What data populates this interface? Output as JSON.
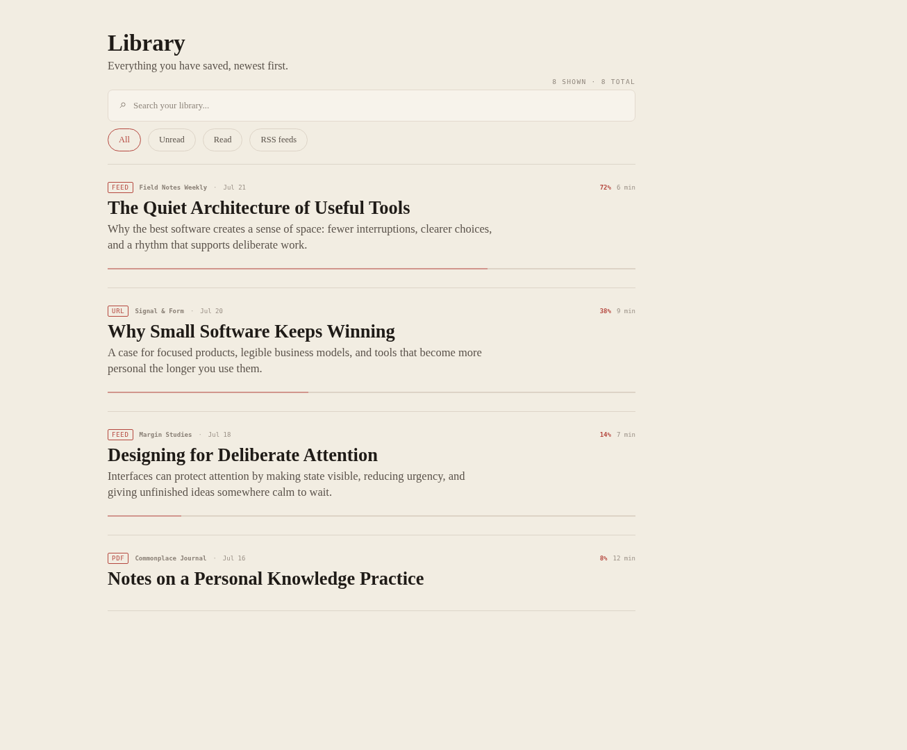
{
  "page": {
    "title": "Library",
    "subtitle": "Everything you have saved, newest first.",
    "count": "8 SHOWN · 8 TOTAL"
  },
  "search": {
    "placeholder": "Search your library..."
  },
  "filters": [
    {
      "label": "All",
      "selected": true
    },
    {
      "label": "Unread",
      "selected": false
    },
    {
      "label": "Read",
      "selected": false
    },
    {
      "label": "RSS feeds",
      "selected": false
    }
  ],
  "items": [
    {
      "type": "FEED",
      "source": "Field Notes Weekly",
      "separator": "·",
      "date": "Jul 21",
      "percent": "72%",
      "duration": "6 min",
      "title": "The Quiet Architecture of Useful Tools",
      "summary": "Why the best software creates a sense of space: fewer interruptions, clearer choices, and a rhythm that supports deliberate work.",
      "level": 0.72
    },
    {
      "type": "URL",
      "source": "Signal & Form",
      "separator": "·",
      "date": "Jul 20",
      "percent": "38%",
      "duration": "9 min",
      "title": "Why Small Software Keeps Winning",
      "summary": "A case for focused products, legible business models, and tools that become more personal the longer you use them.",
      "level": 0.38
    },
    {
      "type": "FEED",
      "source": "Margin Studies",
      "separator": "·",
      "date": "Jul 18",
      "percent": "14%",
      "duration": "7 min",
      "title": "Designing for Deliberate Attention",
      "summary": "Interfaces can protect attention by making state visible, reducing urgency, and giving unfinished ideas somewhere calm to wait.",
      "level": 0.14
    },
    {
      "type": "PDF",
      "source": "Commonplace Journal",
      "separator": "·",
      "date": "Jul 16",
      "percent": "8%",
      "duration": "12 min",
      "title": "Notes on a Personal Knowledge Practice"
    }
  ]
}
